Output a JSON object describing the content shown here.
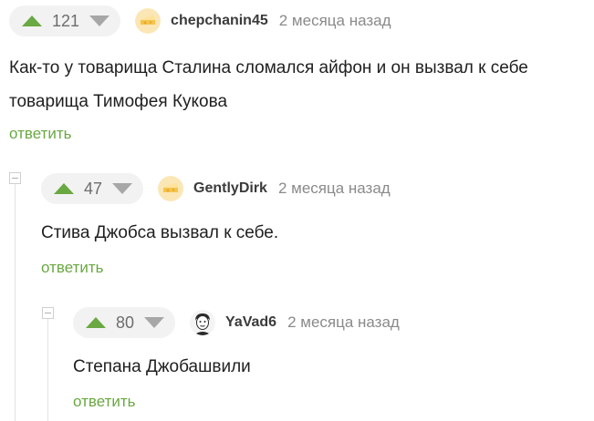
{
  "comments": [
    {
      "score": "121",
      "username": "chepchanin45",
      "time": "2 месяца назад",
      "text_lines": [
        "Как-то у товарища Сталина сломался айфон и он вызвал к себе",
        "товарища Тимофея Кукова"
      ],
      "reply_label": "ответить"
    },
    {
      "score": "47",
      "username": "GentlyDirk",
      "time": "2 месяца назад",
      "text_lines": [
        "Стива Джобса вызвал к себе."
      ],
      "reply_label": "ответить"
    },
    {
      "score": "80",
      "username": "YaVad6",
      "time": "2 месяца назад",
      "text_lines": [
        "Степана Джобашвили"
      ],
      "reply_label": "ответить"
    }
  ],
  "colors": {
    "upvote": "#6aa842",
    "downvote": "#a7a7a7",
    "reply_link": "#6aa842",
    "vote_bg": "#f2f2f2"
  },
  "icons": {
    "upvote": "arrow-up-icon",
    "downvote": "arrow-down-icon",
    "default_avatar": "cheese-avatar",
    "user_avatar": "face-avatar",
    "collapse": "collapse-minus-icon"
  }
}
